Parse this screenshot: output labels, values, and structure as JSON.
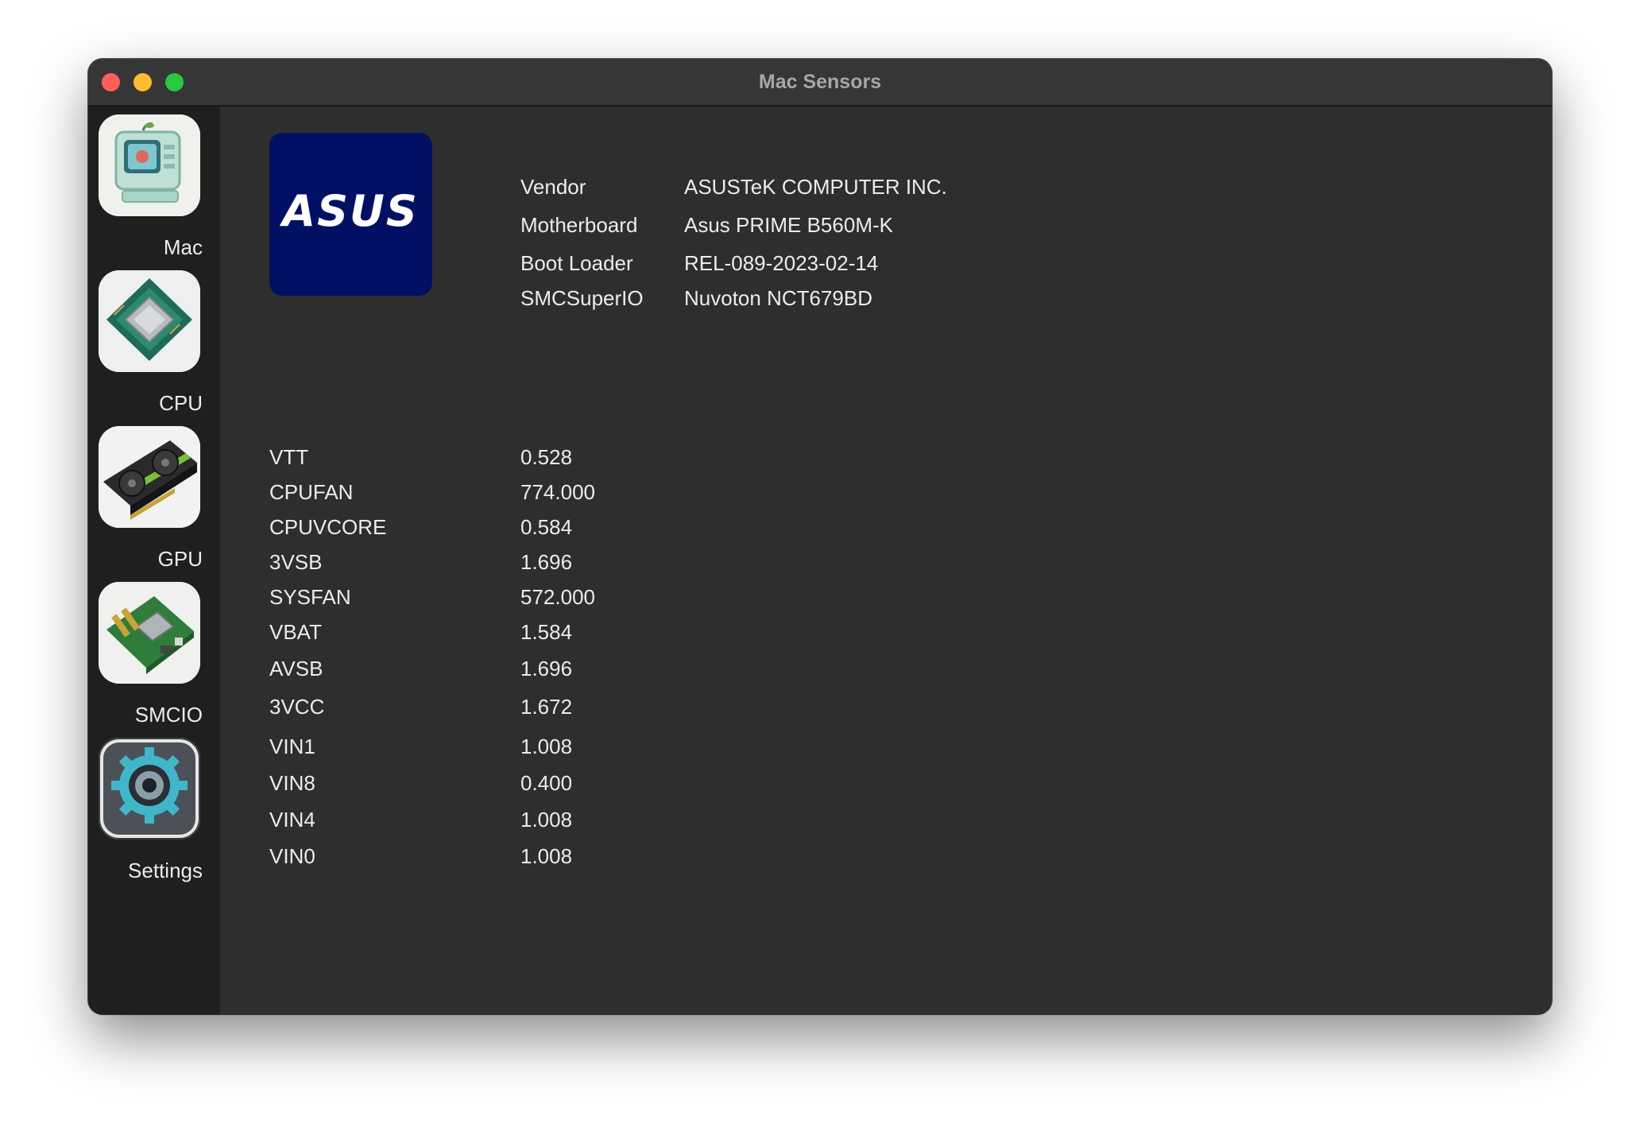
{
  "window": {
    "title": "Mac Sensors"
  },
  "sidebar": {
    "items": [
      {
        "label": "Mac",
        "icon": "retro-computer-icon"
      },
      {
        "label": "CPU",
        "icon": "cpu-chip-icon"
      },
      {
        "label": "GPU",
        "icon": "graphics-card-icon"
      },
      {
        "label": "SMCIO",
        "icon": "motherboard-icon"
      },
      {
        "label": "Settings",
        "icon": "gear-icon"
      }
    ]
  },
  "board": {
    "logo_text": "ASUS",
    "logo_color": "#021064",
    "info": [
      {
        "key": "Vendor",
        "value": "ASUSTeK COMPUTER INC."
      },
      {
        "key": "Motherboard",
        "value": "Asus PRIME B560M-K"
      },
      {
        "key": "Boot Loader",
        "value": "REL-089-2023-02-14"
      },
      {
        "key": "SMCSuperIO",
        "value": "Nuvoton NCT679BD"
      }
    ]
  },
  "sensors": [
    {
      "name": "VTT",
      "value": "0.528"
    },
    {
      "name": "CPUFAN",
      "value": "774.000"
    },
    {
      "name": "CPUVCORE",
      "value": "0.584"
    },
    {
      "name": "3VSB",
      "value": "1.696"
    },
    {
      "name": "SYSFAN",
      "value": "572.000"
    },
    {
      "name": "VBAT",
      "value": "1.584"
    },
    {
      "name": "AVSB",
      "value": "1.696"
    },
    {
      "name": "3VCC",
      "value": "1.672"
    },
    {
      "name": "VIN1",
      "value": "1.008"
    },
    {
      "name": "VIN8",
      "value": "0.400"
    },
    {
      "name": "VIN4",
      "value": "1.008"
    },
    {
      "name": "VIN0",
      "value": "1.008"
    }
  ]
}
